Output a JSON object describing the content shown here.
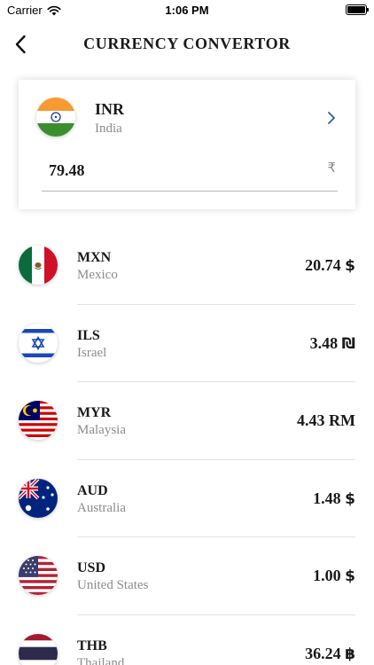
{
  "status_bar": {
    "carrier": "Carrier",
    "time": "1:06 PM",
    "battery_level": 1.0
  },
  "header": {
    "title": "CURRENCY CONVERTOR",
    "back_icon": "chevron-left-icon"
  },
  "base": {
    "code": "INR",
    "country": "India",
    "amount": "79.48",
    "symbol": "₹",
    "flag_icon": "india-flag-icon",
    "select_icon": "chevron-right-icon",
    "accent_color": "#3b5998"
  },
  "rates": [
    {
      "code": "MXN",
      "country": "Mexico",
      "value": "20.74",
      "symbol": "$",
      "flag_icon": "mexico-flag-icon"
    },
    {
      "code": "ILS",
      "country": "Israel",
      "value": "3.48",
      "symbol": "₪",
      "flag_icon": "israel-flag-icon"
    },
    {
      "code": "MYR",
      "country": "Malaysia",
      "value": "4.43",
      "symbol": "RM",
      "flag_icon": "malaysia-flag-icon"
    },
    {
      "code": "AUD",
      "country": "Australia",
      "value": "1.48",
      "symbol": "$",
      "flag_icon": "australia-flag-icon"
    },
    {
      "code": "USD",
      "country": "United States",
      "value": "1.00",
      "symbol": "$",
      "flag_icon": "usa-flag-icon"
    },
    {
      "code": "THB",
      "country": "Thailand",
      "value": "36.24",
      "symbol": "฿",
      "flag_icon": "thailand-flag-icon"
    }
  ]
}
